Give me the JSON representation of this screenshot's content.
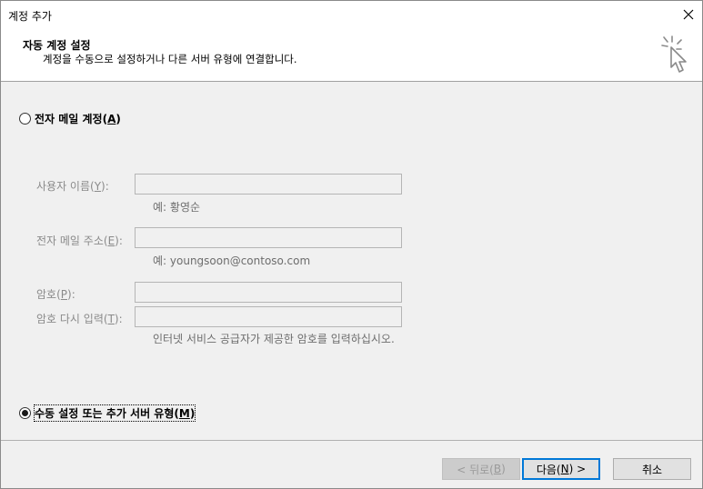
{
  "window": {
    "title": "계정 추가"
  },
  "header": {
    "title": "자동 계정 설정",
    "subtitle": "계정을 수동으로 설정하거나 다른 서버 유형에 연결합니다."
  },
  "options": {
    "email_account": {
      "label": "전자 메일 계정",
      "accesskey": "A",
      "checked": false
    },
    "manual_setup": {
      "label": "수동 설정 또는 추가 서버 유형",
      "accesskey": "M",
      "checked": true
    }
  },
  "fields": {
    "user_name": {
      "label": "사용자 이름",
      "accesskey": "Y",
      "value": "",
      "hint": "예: 황영순"
    },
    "email_address": {
      "label": "전자 메일 주소",
      "accesskey": "E",
      "value": "",
      "hint": "예: youngsoon@contoso.com"
    },
    "password": {
      "label": "암호",
      "accesskey": "P",
      "value": ""
    },
    "password_confirm": {
      "label": "암호 다시 입력",
      "accesskey": "T",
      "value": "",
      "hint": "인터넷 서비스 공급자가 제공한 암호를 입력하십시오."
    }
  },
  "buttons": {
    "back": {
      "prefix": "< 뒤로(",
      "accesskey": "B",
      "suffix": ")",
      "enabled": false
    },
    "next": {
      "prefix": "다음(",
      "accesskey": "N",
      "suffix": ") >",
      "enabled": true
    },
    "cancel": {
      "label": "취소"
    }
  },
  "icons": {
    "close": "close-icon",
    "wizard": "cursor-sparkle-icon"
  }
}
